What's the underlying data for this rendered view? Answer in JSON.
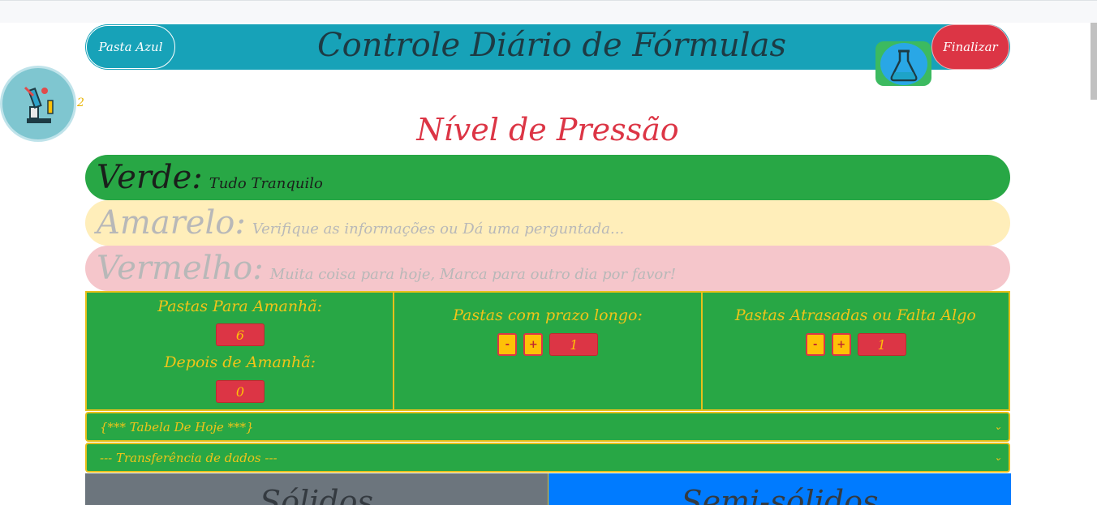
{
  "header": {
    "left_button_label": "Pasta Azul",
    "title": "Controle Diário de Fórmulas",
    "right_button_label": "Finalizar",
    "badge_count": "2"
  },
  "pressure": {
    "title": "Nível de Pressão",
    "levels": [
      {
        "name": "Verde:",
        "desc": "Tudo Tranquilo",
        "color": "#28a745"
      },
      {
        "name": "Amarelo:",
        "desc": "Verifique as informações ou Dá uma perguntada...",
        "color": "#ffeeba"
      },
      {
        "name": "Vermelho:",
        "desc": "Muita coisa para hoje, Marca para outro dia por favor!",
        "color": "#f5c6cb"
      }
    ]
  },
  "counters": {
    "amanha_label": "Pastas Para Amanhã:",
    "amanha_value": "6",
    "depois_label": "Depois de Amanhã:",
    "depois_value": "0",
    "prazo_label": "Pastas com prazo longo:",
    "prazo_value": "1",
    "atrasadas_label": "Pastas Atrasadas ou Falta Algo",
    "atrasadas_value": "1",
    "minus": "-",
    "plus": "+"
  },
  "selects": {
    "table_selected": "{*** Tabela De Hoje ***}",
    "transfer_selected": "--- Transferência de dados ---"
  },
  "categories": {
    "left": "Sólidos",
    "right": "Semi-sólidos"
  }
}
